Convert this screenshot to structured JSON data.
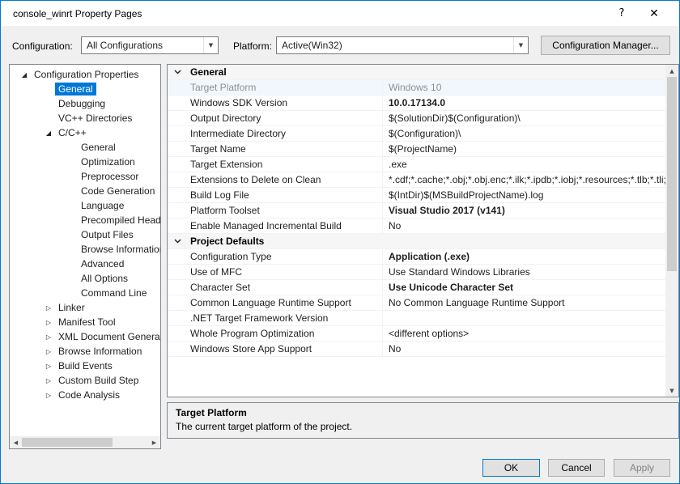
{
  "window": {
    "title": "console_winrt Property Pages"
  },
  "icons": {
    "help": "?",
    "close": "✕",
    "dropdown_arrow": "▼",
    "scroll_up": "▲",
    "scroll_down": "▼",
    "scroll_left": "◀",
    "scroll_right": "▶",
    "tree_expanded": "◢",
    "tree_collapsed": "▷"
  },
  "colors": {
    "accent": "#0078d7",
    "selection": "#0078d7"
  },
  "toolbar": {
    "configuration_label": "Configuration:",
    "configuration_value": "All Configurations",
    "platform_label": "Platform:",
    "platform_value": "Active(Win32)",
    "configuration_manager_label": "Configuration Manager..."
  },
  "tree": {
    "items": [
      {
        "label": "Configuration Properties",
        "level": 0,
        "state": "expanded"
      },
      {
        "label": "General",
        "level": 1,
        "selected": true
      },
      {
        "label": "Debugging",
        "level": 1
      },
      {
        "label": "VC++ Directories",
        "level": 1
      },
      {
        "label": "C/C++",
        "level": 1,
        "state": "expanded"
      },
      {
        "label": "General",
        "level": 2
      },
      {
        "label": "Optimization",
        "level": 2
      },
      {
        "label": "Preprocessor",
        "level": 2
      },
      {
        "label": "Code Generation",
        "level": 2
      },
      {
        "label": "Language",
        "level": 2
      },
      {
        "label": "Precompiled Headers",
        "level": 2
      },
      {
        "label": "Output Files",
        "level": 2
      },
      {
        "label": "Browse Information",
        "level": 2
      },
      {
        "label": "Advanced",
        "level": 2
      },
      {
        "label": "All Options",
        "level": 2
      },
      {
        "label": "Command Line",
        "level": 2
      },
      {
        "label": "Linker",
        "level": 1,
        "state": "collapsed"
      },
      {
        "label": "Manifest Tool",
        "level": 1,
        "state": "collapsed"
      },
      {
        "label": "XML Document Generator",
        "level": 1,
        "state": "collapsed"
      },
      {
        "label": "Browse Information",
        "level": 1,
        "state": "collapsed"
      },
      {
        "label": "Build Events",
        "level": 1,
        "state": "collapsed"
      },
      {
        "label": "Custom Build Step",
        "level": 1,
        "state": "collapsed"
      },
      {
        "label": "Code Analysis",
        "level": 1,
        "state": "collapsed"
      }
    ]
  },
  "grid": {
    "sections": [
      {
        "title": "General",
        "rows": [
          {
            "name": "Target Platform",
            "value": "Windows 10",
            "muted": true
          },
          {
            "name": "Windows SDK Version",
            "value": "10.0.17134.0",
            "bold": true
          },
          {
            "name": "Output Directory",
            "value": "$(SolutionDir)$(Configuration)\\"
          },
          {
            "name": "Intermediate Directory",
            "value": "$(Configuration)\\"
          },
          {
            "name": "Target Name",
            "value": "$(ProjectName)"
          },
          {
            "name": "Target Extension",
            "value": ".exe"
          },
          {
            "name": "Extensions to Delete on Clean",
            "value": "*.cdf;*.cache;*.obj;*.obj.enc;*.ilk;*.ipdb;*.iobj;*.resources;*.tlb;*.tli;*.t"
          },
          {
            "name": "Build Log File",
            "value": "$(IntDir)$(MSBuildProjectName).log"
          },
          {
            "name": "Platform Toolset",
            "value": "Visual Studio 2017 (v141)",
            "bold": true
          },
          {
            "name": "Enable Managed Incremental Build",
            "value": "No"
          }
        ]
      },
      {
        "title": "Project Defaults",
        "rows": [
          {
            "name": "Configuration Type",
            "value": "Application (.exe)",
            "bold": true
          },
          {
            "name": "Use of MFC",
            "value": "Use Standard Windows Libraries"
          },
          {
            "name": "Character Set",
            "value": "Use Unicode Character Set",
            "bold": true
          },
          {
            "name": "Common Language Runtime Support",
            "value": "No Common Language Runtime Support"
          },
          {
            "name": ".NET Target Framework Version",
            "value": ""
          },
          {
            "name": "Whole Program Optimization",
            "value": "<different options>"
          },
          {
            "name": "Windows Store App Support",
            "value": "No"
          }
        ]
      }
    ]
  },
  "description": {
    "title": "Target Platform",
    "body": "The current target platform of the project."
  },
  "buttons": {
    "ok": "OK",
    "cancel": "Cancel",
    "apply": "Apply"
  }
}
